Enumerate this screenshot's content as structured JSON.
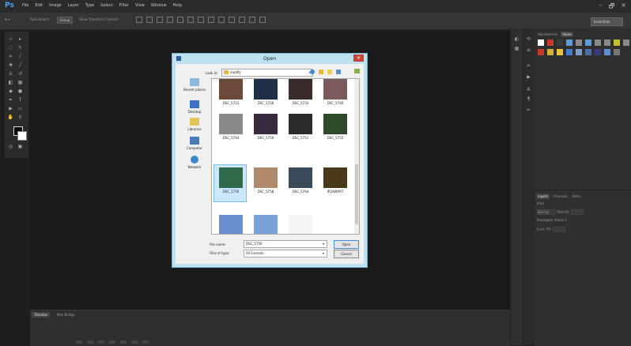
{
  "app": {
    "logo": "Ps",
    "menu": [
      "File",
      "Edit",
      "Image",
      "Layer",
      "Type",
      "Select",
      "Filter",
      "View",
      "Window",
      "Help"
    ],
    "window_controls": [
      "–",
      "🗗",
      "×"
    ]
  },
  "options_bar": {
    "auto_select_label": "Auto-Select:",
    "auto_select_value": "Group",
    "transform_label": "Show Transform Controls",
    "workspace": "Essentials"
  },
  "right_panel": {
    "tabs": [
      "Adjustments",
      "Styles"
    ],
    "swatch_colors": [
      "#ffffff",
      "#c93a2e",
      "#3b3b3b",
      "#5c9bd6",
      "#8a8a8a",
      "#5c9bd6",
      "#8a8a8a",
      "#8a8a8a",
      "#c2bf2b",
      "#8a8a8a",
      "#c93a2e",
      "#d6b23a",
      "#e8c23b",
      "#3f7cc9",
      "#7b9fc8",
      "#4a6fa5",
      "#3a3a80",
      "#5b8dd1",
      "#777777"
    ],
    "layers": {
      "tabs": [
        "Layers",
        "Channels",
        "Paths"
      ],
      "kind": "Kind",
      "blend": "Normal",
      "opacity_label": "Opacity:",
      "lock_label": "Lock:",
      "fill_label": "Fill:",
      "propagate": "Propagate Frame 1"
    }
  },
  "timeline": {
    "tabs": [
      "Timeline",
      "Mini Bridge"
    ]
  },
  "dialog": {
    "title": "Open",
    "look_in_label": "Look in:",
    "look_in_value": "modify",
    "places": [
      "Recent places",
      "Desktop",
      "Libraries",
      "Computer",
      "Network"
    ],
    "files": [
      {
        "name": "DSC_5723",
        "color": "#6b4a3a"
      },
      {
        "name": "DSC_5726",
        "color": "#20304a"
      },
      {
        "name": "DSC_5733",
        "color": "#3a2a2a"
      },
      {
        "name": "DSC_5740",
        "color": "#7a5a5a"
      },
      {
        "name": "DSC_5744",
        "color": "#8a8a8a"
      },
      {
        "name": "DSC_5750",
        "color": "#3a2a40"
      },
      {
        "name": "DSC_5751",
        "color": "#2a2a2a"
      },
      {
        "name": "DSC_5755",
        "color": "#2f4a2a"
      },
      {
        "name": "DSC_5756",
        "color": "#2f6a4a"
      },
      {
        "name": "DSC_5758",
        "color": "#b08a6a"
      },
      {
        "name": "DSC_5764",
        "color": "#3a4a5a"
      },
      {
        "name": "IP24WR97",
        "color": "#4a3a1a"
      }
    ],
    "file_name_label": "File name:",
    "file_name_value": "DSC_5756",
    "file_type_label": "Files of type:",
    "file_type_value": "All Formats",
    "open_button": "Open",
    "cancel_button": "Cancel"
  }
}
